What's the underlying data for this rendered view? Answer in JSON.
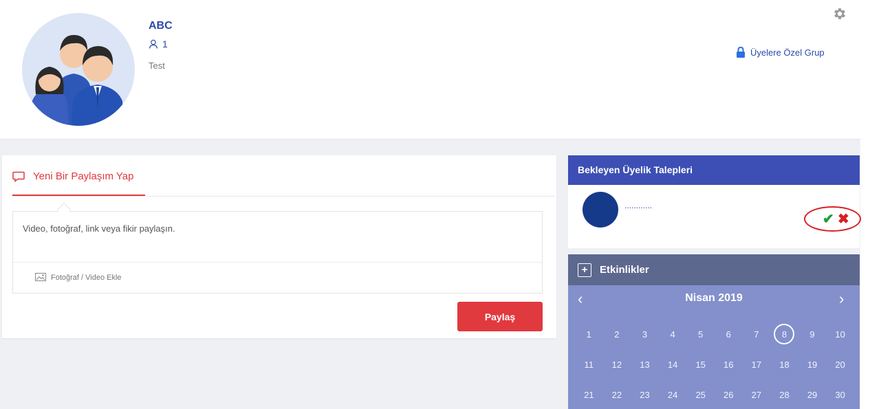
{
  "group": {
    "name": "ABC",
    "member_count": "1",
    "description": "Test",
    "privacy_label": "Üyelere Özel Grup"
  },
  "post": {
    "tab_label": "Yeni Bir Paylaşım Yap",
    "placeholder": "Video, fotoğraf, link veya fikir paylaşın.",
    "media_label": "Fotoğraf / Video Ekle",
    "share_label": "Paylaş"
  },
  "pending": {
    "title": "Bekleyen Üyelik Talepleri",
    "requester_name": "............"
  },
  "events": {
    "title": "Etkinlikler",
    "month": "Nisan 2019",
    "today": "8",
    "days": [
      "1",
      "2",
      "3",
      "4",
      "5",
      "6",
      "7",
      "8",
      "9",
      "10",
      "11",
      "12",
      "13",
      "14",
      "15",
      "16",
      "17",
      "18",
      "19",
      "20",
      "21",
      "22",
      "23",
      "24",
      "25",
      "26",
      "27",
      "28",
      "29",
      "30"
    ]
  },
  "colors": {
    "accent_red": "#e0393e",
    "primary_blue": "#3d4fb4",
    "calendar_bg": "#8390cb",
    "events_header": "#5d688e",
    "approve": "#1e9e3a",
    "reject": "#d81f26"
  },
  "icons": {
    "settings": "gear-icon",
    "privacy": "lock-icon",
    "members": "user-icon",
    "post_tab": "comment-icon",
    "media": "image-icon",
    "add_event": "plus-icon",
    "approve": "check-icon",
    "reject": "close-icon"
  }
}
